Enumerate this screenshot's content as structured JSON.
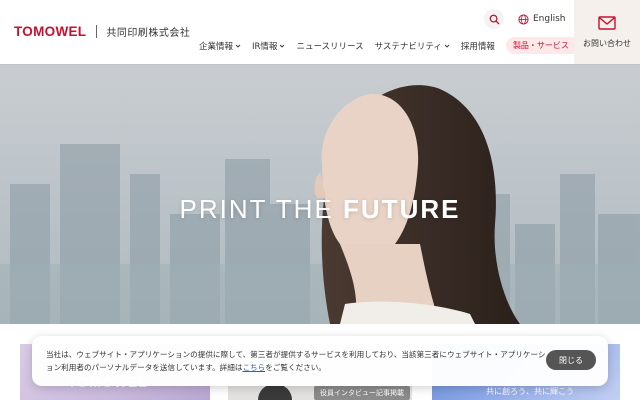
{
  "header": {
    "logo_main": "TOMOWEL",
    "logo_sub": "共同印刷株式会社",
    "search_icon": "search-icon",
    "language_label": "English",
    "language_icon": "globe-icon",
    "nav": [
      {
        "label": "企業情報",
        "has_dropdown": true
      },
      {
        "label": "IR情報",
        "has_dropdown": true
      },
      {
        "label": "ニュースリリース",
        "has_dropdown": false
      },
      {
        "label": "サステナビリティ",
        "has_dropdown": true
      },
      {
        "label": "採用情報",
        "has_dropdown": false
      }
    ],
    "products_pill": "製品・サービス",
    "contact_label": "お問い合わせ",
    "contact_icon": "mail-icon",
    "brand_color": "#c8102e"
  },
  "hero": {
    "title_light": "PRINT THE ",
    "title_bold": "FUTURE"
  },
  "cards": {
    "card1_text": "TOMOWEL",
    "card2_tag": "役員インタビュー記事掲載",
    "card3_text": "共に創ろう、共に輝こう"
  },
  "cookie": {
    "text_before_link": "当社は、ウェブサイト・アプリケーションの提供に際して、第三者が提供するサービスを利用しており、当該第三者にウェブサイト・アプリケーション利用者のパーソナルデータを送信しています。詳細は",
    "link_label": "こちら",
    "text_after_link": "をご覧ください。",
    "close_label": "閉じる"
  }
}
